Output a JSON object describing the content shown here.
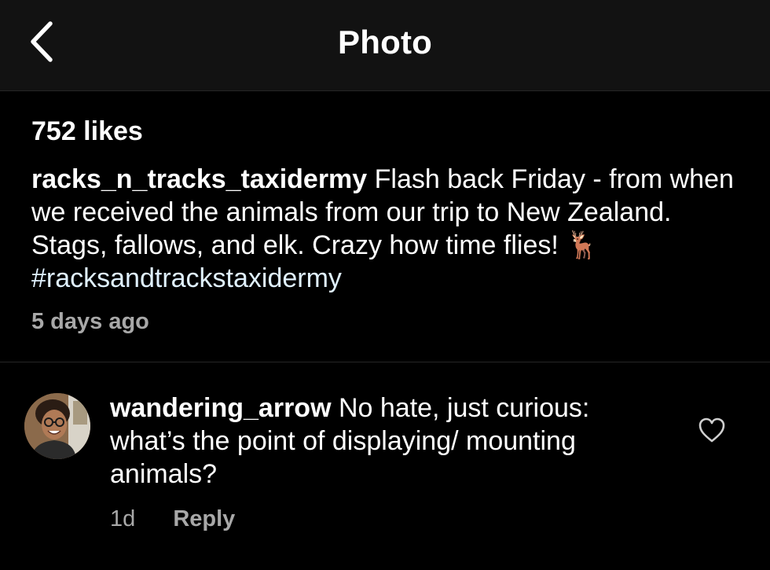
{
  "header": {
    "title": "Photo",
    "back_icon": "chevron-left-icon"
  },
  "post": {
    "likes": "752 likes",
    "username": "racks_n_tracks_taxidermy",
    "caption_text": "Flash back Friday - from when we received the animals from our trip to New Zealand. Stags, fallows, and elk. Crazy how time flies!",
    "emoji": "🦌",
    "hashtag": "#racksandtrackstaxidermy",
    "timestamp": "5 days ago",
    "hashtag_color": "#e0f1ff"
  },
  "comment": {
    "username": "wandering_arrow",
    "text": "No hate, just curious: what’s the point of displaying/ mounting animals?",
    "time": "1d",
    "reply_label": "Reply",
    "like_icon": "heart-outline-icon",
    "avatar": "user-avatar"
  },
  "colors": {
    "background": "#000000",
    "header_background": "#121212",
    "secondary_text": "#a8a8a8",
    "divider": "#262626"
  }
}
